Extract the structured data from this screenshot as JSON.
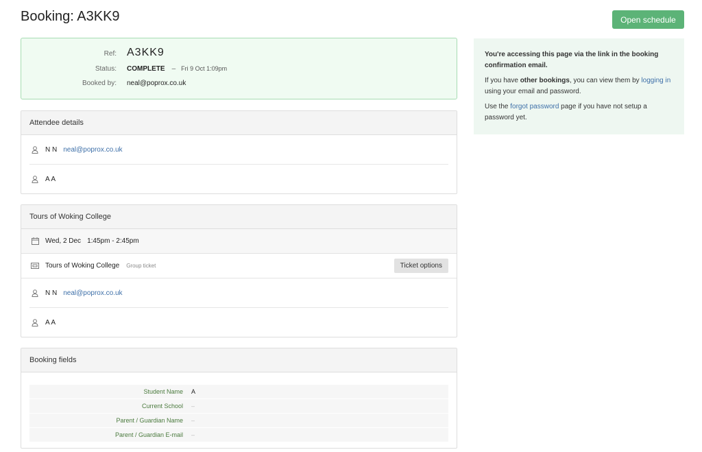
{
  "page": {
    "title": "Booking: A3KK9"
  },
  "header": {
    "open_schedule": "Open schedule"
  },
  "summary": {
    "ref_label": "Ref:",
    "ref": "A3KK9",
    "status_label": "Status:",
    "status": "COMPLETE",
    "dash": "–",
    "status_date": "Fri 9 Oct 1:09pm",
    "booked_by_label": "Booked by:",
    "booked_by": "neal@poprox.co.uk"
  },
  "attendees": {
    "title": "Attendee details",
    "items": [
      {
        "name": "N N",
        "email": "neal@poprox.co.uk"
      },
      {
        "name": "A A",
        "email": ""
      }
    ]
  },
  "event": {
    "title": "Tours of Woking College",
    "date": "Wed, 2 Dec",
    "time": "1:45pm - 2:45pm",
    "ticket_name": "Tours of Woking College",
    "ticket_type": "Group ticket",
    "ticket_options": "Ticket options",
    "attendees": [
      {
        "name": "N N",
        "email": "neal@poprox.co.uk"
      },
      {
        "name": "A A",
        "email": ""
      }
    ]
  },
  "booking_fields": {
    "title": "Booking fields",
    "rows": [
      {
        "label": "Student Name",
        "value": "A"
      },
      {
        "label": "Current School",
        "value": "–"
      },
      {
        "label": "Parent / Guardian Name",
        "value": "–"
      },
      {
        "label": "Parent / Guardian E-mail",
        "value": "–"
      }
    ]
  },
  "info": {
    "p1": "You're accessing this page via the link in the booking confirmation email.",
    "p2_a": "If you have ",
    "p2_b": "other bookings",
    "p2_c": ", you can view them by ",
    "p2_link": "logging in",
    "p2_d": " using your email and password.",
    "p3_a": "Use the ",
    "p3_link": "forgot password",
    "p3_b": " page if you have not setup a password yet."
  },
  "colors": {
    "accent": "#5cb377",
    "link": "#3d6fa8",
    "summary_bg": "#f0fbf2",
    "info_bg": "#eef7f1"
  }
}
